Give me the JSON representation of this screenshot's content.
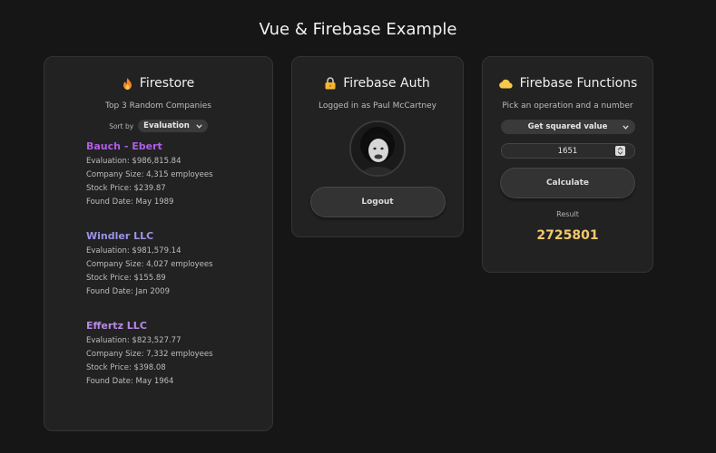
{
  "page": {
    "title": "Vue & Firebase Example"
  },
  "firestore": {
    "title": "Firestore",
    "subtitle": "Top 3 Random Companies",
    "sort_label": "Sort by",
    "sort_value": "Evaluation",
    "companies": [
      {
        "name": "Bauch - Ebert",
        "color": "#b05ee8",
        "evaluation": "Evaluation: $986,815.84",
        "size": "Company Size: 4,315 employees",
        "stock": "Stock Price: $239.87",
        "found": "Found Date: May 1989"
      },
      {
        "name": "Windler LLC",
        "color": "#9b93e6",
        "evaluation": "Evaluation: $981,579.14",
        "size": "Company Size: 4,027 employees",
        "stock": "Stock Price: $155.89",
        "found": "Found Date: Jan 2009"
      },
      {
        "name": "Effertz LLC",
        "color": "#b58ae6",
        "evaluation": "Evaluation: $823,527.77",
        "size": "Company Size: 7,332 employees",
        "stock": "Stock Price: $398.08",
        "found": "Found Date: May 1964"
      }
    ]
  },
  "auth": {
    "title": "Firebase Auth",
    "status": "Logged in as Paul McCartney",
    "logout_label": "Logout"
  },
  "functions": {
    "title": "Firebase Functions",
    "subtitle": "Pick an operation and a number",
    "operation": "Get squared value",
    "number": "1651",
    "calculate_label": "Calculate",
    "result_label": "Result",
    "result_value": "2725801"
  },
  "icons": {
    "firestore": "flame-icon",
    "auth": "lock-icon",
    "functions": "cloud-icon"
  }
}
